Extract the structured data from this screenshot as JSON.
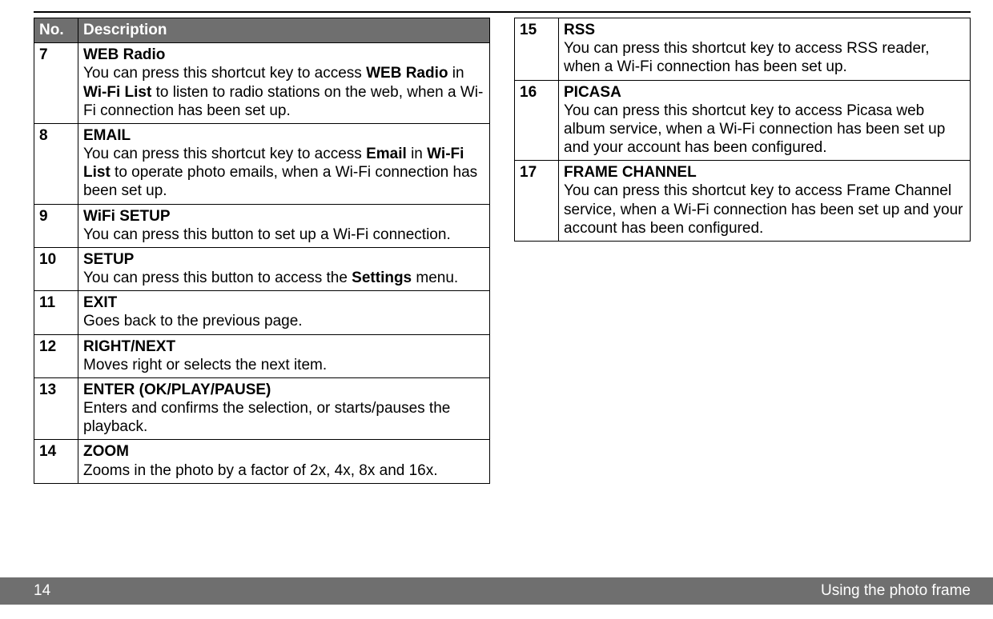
{
  "header": {
    "no": "No.",
    "desc": "Description"
  },
  "left": [
    {
      "no": "7",
      "title": "WEB Radio",
      "desc_html": "You can press this shortcut key to access <b>WEB Radio</b> in <b>Wi-Fi List</b> to listen to radio stations on the web, when a Wi-Fi connection has been set up."
    },
    {
      "no": "8",
      "title": "EMAIL",
      "desc_html": "You can press this shortcut key to access <b>Email</b> in <b>Wi-Fi List</b> to operate photo emails, when a Wi-Fi connection has been set up."
    },
    {
      "no": "9",
      "title": "WiFi SETUP",
      "desc_html": "You can press this button to set up a Wi-Fi connection."
    },
    {
      "no": "10",
      "title": "SETUP",
      "desc_html": "You can press this button to access the <b>Settings</b> menu."
    },
    {
      "no": "11",
      "title": "EXIT",
      "desc_html": "Goes back to the previous page."
    },
    {
      "no": "12",
      "title": "RIGHT/NEXT",
      "desc_html": "Moves right or selects the next item."
    },
    {
      "no": "13",
      "title": "ENTER (OK/PLAY/PAUSE)",
      "desc_html": "Enters and confirms the selection, or starts/pauses the playback."
    },
    {
      "no": "14",
      "title": "ZOOM",
      "desc_html": "Zooms in the photo by a factor of 2x, 4x, 8x and 16x."
    }
  ],
  "right": [
    {
      "no": "15",
      "title": "RSS",
      "desc_html": "You can press this shortcut key to access RSS reader, when a Wi-Fi connection has been set up."
    },
    {
      "no": "16",
      "title": "PICASA",
      "desc_html": "You can press this shortcut key to access Picasa web album service, when a Wi-Fi connection has been set up and your account has been configured."
    },
    {
      "no": "17",
      "title": "FRAME CHANNEL",
      "desc_html": "You can press this shortcut key to access Frame Channel service, when a Wi-Fi connection has been set up and your account has been configured."
    }
  ],
  "footer": {
    "page": "14",
    "section": "Using the photo frame"
  }
}
